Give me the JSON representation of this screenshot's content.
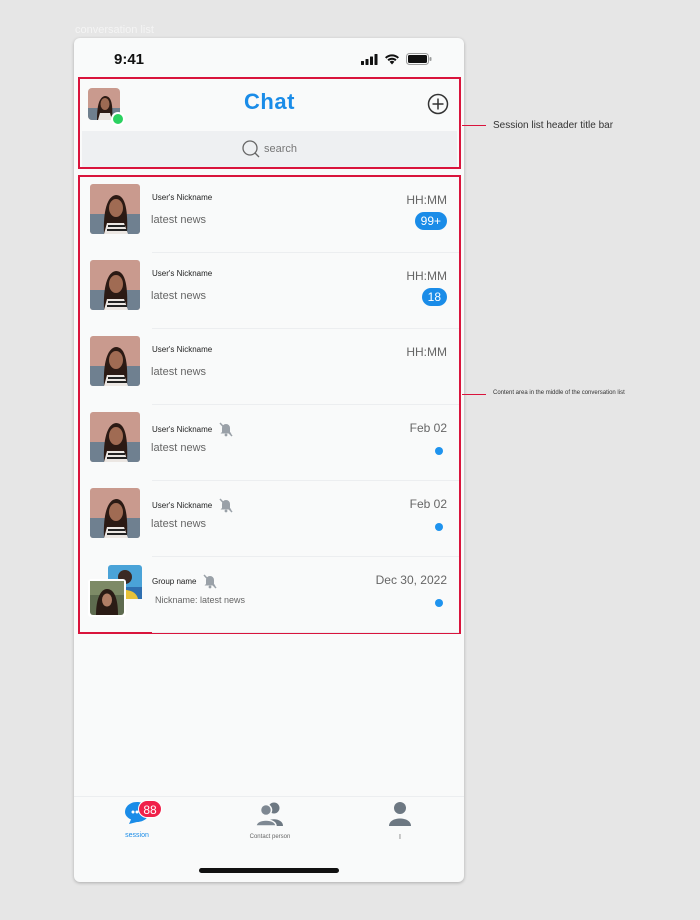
{
  "canvas_label": "conversation list",
  "status_bar": {
    "time": "9:41"
  },
  "header": {
    "title": "Chat",
    "search_placeholder": "search"
  },
  "conversations": [
    {
      "name": "User's Nickname",
      "message": "latest news",
      "time": "HH:MM",
      "badge": "99+",
      "muted": false
    },
    {
      "name": "User's Nickname",
      "message": "latest news",
      "time": "HH:MM",
      "badge": "18",
      "muted": false
    },
    {
      "name": "User's Nickname",
      "message": "latest news",
      "time": "HH:MM",
      "badge": "",
      "muted": false
    },
    {
      "name": "User's Nickname",
      "message": "latest news",
      "time": "Feb 02",
      "badge": "",
      "muted": true,
      "unread_dot": true
    },
    {
      "name": "User's Nickname",
      "message": "latest news",
      "time": "Feb 02",
      "badge": "",
      "muted": true,
      "unread_dot": true
    },
    {
      "name": "Group name",
      "message": "Nickname: latest news",
      "time": "Dec 30, 2022",
      "badge": "",
      "muted": true,
      "unread_dot": true,
      "group": true
    }
  ],
  "tab_bar": {
    "session_label": "session",
    "session_badge": "88",
    "contacts_label": "Contact person",
    "me_label": "I"
  },
  "annotations": {
    "header_note": "Session list header title bar",
    "content_note": "Content area in the middle of the conversation list"
  },
  "colors": {
    "accent": "#1a8ce8",
    "annotation_red": "#d9143c",
    "badge_red": "#f0214a",
    "online_green": "#2bd160"
  },
  "icons": [
    "signal-icon",
    "wifi-icon",
    "battery-icon",
    "add-icon",
    "search-icon",
    "mute-icon",
    "chat-bubble-icon",
    "contacts-icon",
    "person-icon"
  ]
}
